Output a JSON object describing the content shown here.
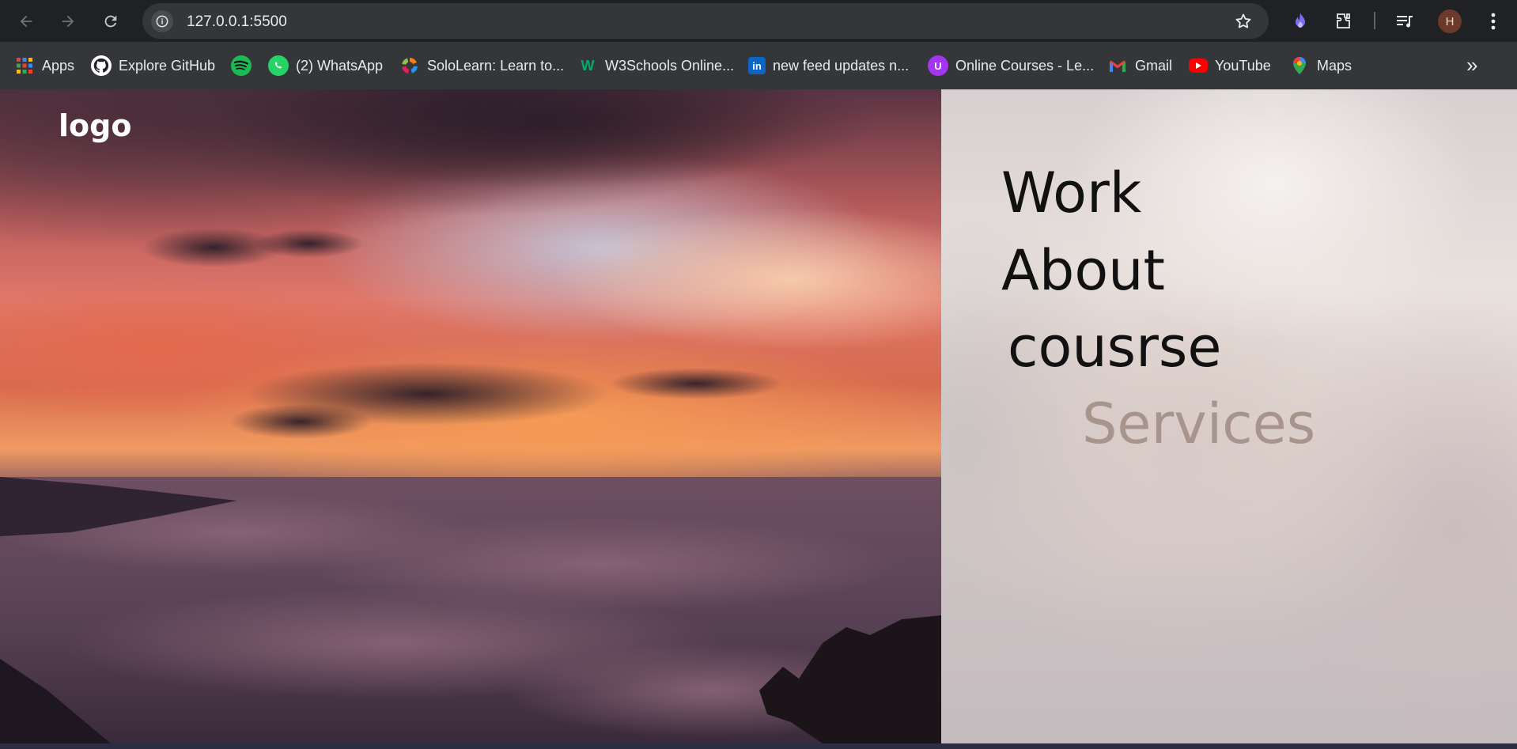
{
  "browser": {
    "url": "127.0.0.1:5500",
    "nav": {
      "back_icon": "arrow-left",
      "forward_icon": "arrow-right",
      "reload_icon": "reload"
    },
    "profile_initial": "H"
  },
  "bookmarks": [
    {
      "label": "Apps",
      "icon": "apps-grid",
      "color": "#ea4335"
    },
    {
      "label": "Explore GitHub",
      "icon": "github",
      "color": "#ffffff"
    },
    {
      "label": "",
      "icon": "spotify",
      "color": "#1db954"
    },
    {
      "label": "(2) WhatsApp",
      "icon": "whatsapp",
      "color": "#25d366"
    },
    {
      "label": "SoloLearn: Learn to...",
      "icon": "sololearn",
      "color": "#f57f17"
    },
    {
      "label": "W3Schools Online...",
      "icon": "w3schools",
      "color": "#04aa6d"
    },
    {
      "label": "new feed updates n...",
      "icon": "linkedin",
      "color": "#0a66c2"
    },
    {
      "label": "Online Courses - Le...",
      "icon": "udemy",
      "color": "#a435f0"
    },
    {
      "label": "Gmail",
      "icon": "gmail",
      "color": "#ea4335"
    },
    {
      "label": "YouTube",
      "icon": "youtube",
      "color": "#ff0000"
    },
    {
      "label": "Maps",
      "icon": "google-maps",
      "color": "#34a853"
    }
  ],
  "site": {
    "logo": "logo",
    "menu": [
      "Work",
      "About",
      "cousrse",
      "Services"
    ]
  }
}
